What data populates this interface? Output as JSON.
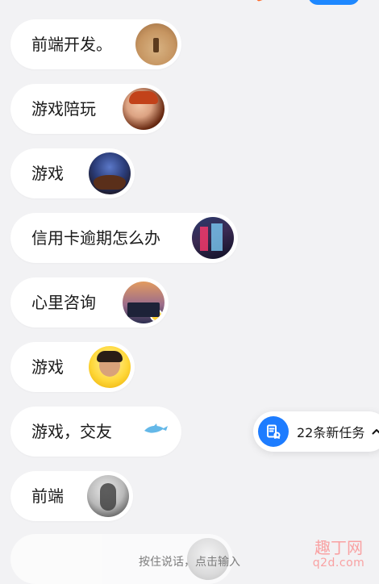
{
  "chat_list": {
    "items": [
      {
        "label": "前端开发。",
        "avatar_icon": "desert-photo-avatar"
      },
      {
        "label": "游戏陪玩",
        "avatar_icon": "child-photo-avatar"
      },
      {
        "label": "游戏",
        "avatar_icon": "night-landscape-avatar"
      },
      {
        "label": "信用卡逾期怎么办",
        "avatar_icon": "city-lights-avatar"
      },
      {
        "label": "心里咨询",
        "avatar_icon": "skyline-avatar",
        "badge_icon": "verified-badge-icon"
      },
      {
        "label": "游戏",
        "avatar_icon": "person-portrait-avatar"
      },
      {
        "label": "游戏，交友",
        "decor_icon": "dolphin-icon"
      },
      {
        "label": "前端",
        "avatar_icon": "ink-portrait-avatar"
      }
    ]
  },
  "task_pill": {
    "text": "22条新任务",
    "icon": "task-icon",
    "chevron_icon": "chevron-up-icon"
  },
  "bottom_hint": {
    "text": "按住说话，点击输入"
  },
  "watermark": {
    "line1": "趣丁网",
    "line2": "q2d.com"
  },
  "colors": {
    "background": "#f2f2f4",
    "card": "#ffffff",
    "accent_blue": "#1d7cff",
    "watermark_red": "#ff5e5e"
  }
}
